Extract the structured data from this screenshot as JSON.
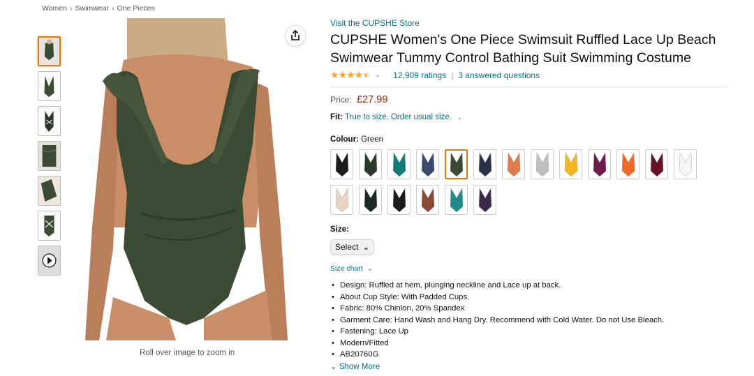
{
  "breadcrumb": [
    "Women",
    "Swimwear",
    "One Pieces"
  ],
  "breadcrumb_sep": "›",
  "store_link": "Visit the CUPSHE Store",
  "title": "CUPSHE Women's One Piece Swimsuit Ruffled Lace Up Beach Swimwear Tummy Control Bathing Suit Swimming Costume",
  "rating": {
    "stars": 4.5,
    "count_label": "12,909 ratings",
    "answered": "3 answered questions",
    "star_color": "#ffa41c"
  },
  "price": {
    "label": "Price:",
    "value": "£27.99",
    "color": "#b12704"
  },
  "fit": {
    "label": "Fit:",
    "text": "True to size. Order usual size."
  },
  "colour": {
    "label": "Colour:",
    "value": "Green"
  },
  "swatch_colors": [
    "#1c1c1c",
    "#2a3a2a",
    "#0f7d73",
    "#3a4a6e",
    "#3b4a32",
    "#2a2f4a",
    "#e07a4a",
    "#bfbfbf",
    "#f2b81e",
    "#6e1a4a",
    "#ee6a2a",
    "#6a1027",
    "#f5f5f5",
    "#e9d3c5",
    "#1d2a24",
    "#1c1c1c",
    "#8a4a33",
    "#1f8a8a",
    "#3a2a4a"
  ],
  "selected_swatch": 4,
  "size": {
    "label": "Size:",
    "select_value": "Select"
  },
  "size_chart": "Size chart",
  "bullets": [
    "Design: Ruffled at hem, plunging neckline and Lace up at back.",
    "About Cup Style: With Padded Cups.",
    "Fabric: 80% Chinlon, 20% Spandex",
    "Garment Care: Hand Wash and Hang Dry. Recommend with Cold Water. Do not Use Bleach.",
    "Fastening: Lace Up",
    "Modern/Fitted",
    "AB20760G"
  ],
  "show_more": "Show More",
  "zoom_hint": "Roll over image to zoom in",
  "icons": {
    "share": "share-icon",
    "play": "play-icon"
  },
  "accent_color": "#007185",
  "product_color": "#3b4a32"
}
